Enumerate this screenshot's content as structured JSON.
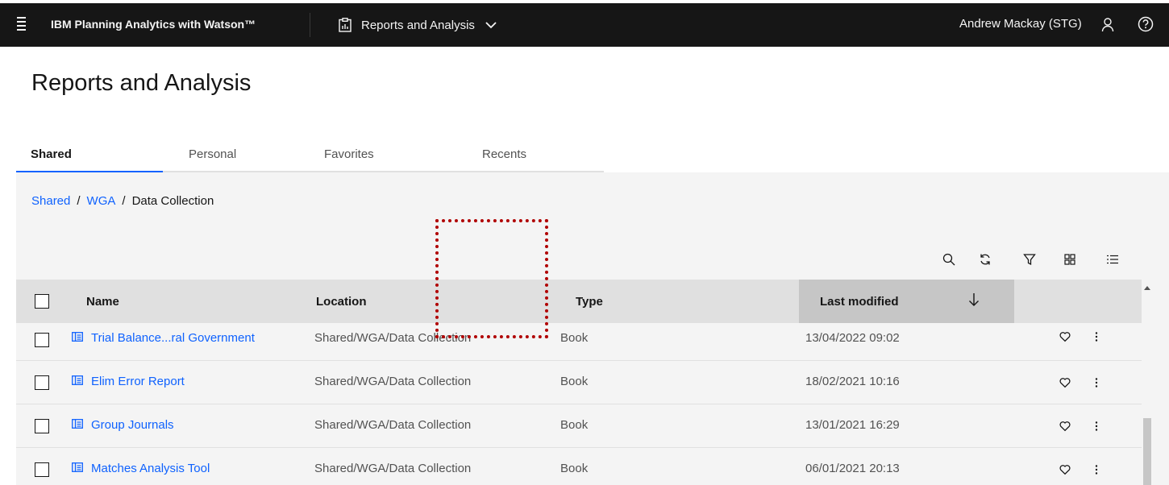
{
  "topbar": {
    "product": "IBM Planning Analytics with Watson™",
    "app_name": "Reports and Analysis",
    "user": "Andrew Mackay (STG)",
    "menu_icon": "hamburger-menu-icon",
    "app_icon": "report-clipboard-icon",
    "user_icon": "user-icon",
    "help_icon": "help-icon"
  },
  "page": {
    "title": "Reports and Analysis"
  },
  "tabs": [
    {
      "label": "Shared",
      "active": true
    },
    {
      "label": "Personal",
      "active": false
    },
    {
      "label": "Favorites",
      "active": false
    },
    {
      "label": "Recents",
      "active": false
    }
  ],
  "breadcrumb": [
    {
      "label": "Shared",
      "link": true
    },
    {
      "label": "WGA",
      "link": true
    },
    {
      "label": "Data Collection",
      "link": false
    }
  ],
  "toolbar": [
    "search-icon",
    "refresh-icon",
    "filter-icon",
    "tile-view-icon",
    "list-view-icon"
  ],
  "table": {
    "headers": {
      "name": "Name",
      "location": "Location",
      "type": "Type",
      "last_modified": "Last modified"
    },
    "sort": {
      "column": "last_modified",
      "direction": "descending"
    },
    "rows": [
      {
        "name": "Trial Balance...ral Government",
        "location": "Shared/WGA/Data Collection",
        "type": "Book",
        "modified": "13/04/2022 09:02"
      },
      {
        "name": "Elim Error Report",
        "location": "Shared/WGA/Data Collection",
        "type": "Book",
        "modified": "18/02/2021 10:16"
      },
      {
        "name": "Group Journals",
        "location": "Shared/WGA/Data Collection",
        "type": "Book",
        "modified": "13/01/2021 16:29"
      },
      {
        "name": "Matches Analysis Tool",
        "location": "Shared/WGA/Data Collection",
        "type": "Book",
        "modified": "06/01/2021 20:13"
      }
    ]
  },
  "colors": {
    "topbar": "#161616",
    "link": "#0f62fe",
    "active_tab": "#0f62fe",
    "annotation": "#b00000"
  }
}
